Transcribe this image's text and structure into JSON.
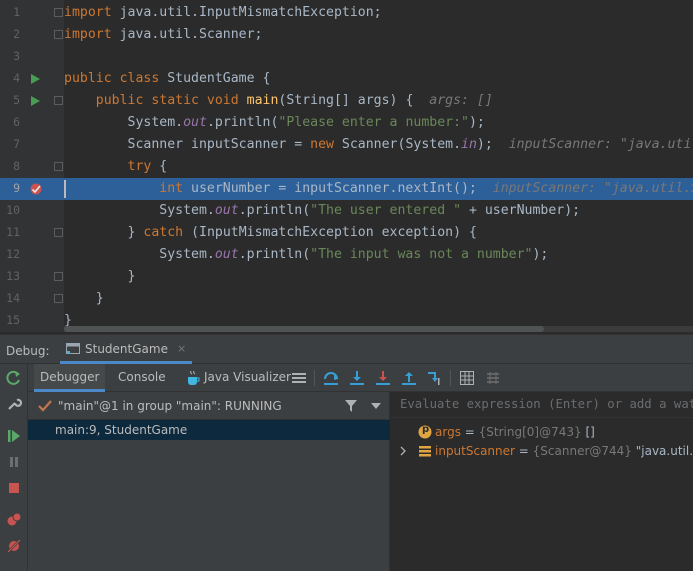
{
  "editor": {
    "lines": [
      {
        "n": "1"
      },
      {
        "n": "2"
      },
      {
        "n": "3"
      },
      {
        "n": "4"
      },
      {
        "n": "5"
      },
      {
        "n": "6"
      },
      {
        "n": "7"
      },
      {
        "n": "8"
      },
      {
        "n": "9"
      },
      {
        "n": "10"
      },
      {
        "n": "11"
      },
      {
        "n": "12"
      },
      {
        "n": "13"
      },
      {
        "n": "14"
      },
      {
        "n": "15"
      }
    ],
    "code": {
      "l1_kw": "import",
      "l1_rest": " java.util.InputMismatchException;",
      "l2_kw": "import",
      "l2_rest": " java.util.Scanner;",
      "l4_kw": "public class",
      "l4_rest": " StudentGame {",
      "l5_kw": "public static void",
      "l5_fn": "main",
      "l5_rest": "(String[] args) {",
      "l5_hint": "args: []",
      "l6_a": "System.",
      "l6_fld": "out",
      "l6_b": ".println(",
      "l6_str": "\"Please enter a number:\"",
      "l6_c": ");",
      "l7_a": "Scanner inputScanner = ",
      "l7_kw": "new",
      "l7_b": " Scanner(System.",
      "l7_fld": "in",
      "l7_c": ");",
      "l7_hint": "inputScanner: \"java.util.Scanner[delimiters=",
      "l8_kw": "try",
      "l8_rest": " {",
      "l9_kw": "int",
      "l9_rest": " userNumber = inputScanner.nextInt();",
      "l9_hint": "inputScanner: \"java.util.Scanner[deli",
      "l10_a": "System.",
      "l10_fld": "out",
      "l10_b": ".println(",
      "l10_str": "\"The user entered \"",
      "l10_c": " + userNumber);",
      "l11_a": "} ",
      "l11_kw": "catch",
      "l11_b": " (InputMismatchException exception) {",
      "l12_a": "System.",
      "l12_fld": "out",
      "l12_b": ".println(",
      "l12_str": "\"The input was not a number\"",
      "l12_c": ");",
      "l13": "}",
      "l14": "}",
      "l15": "}"
    }
  },
  "debug": {
    "title": "Debug:",
    "session_tab": "StudentGame",
    "session_close": "×",
    "tabs": {
      "debugger": "Debugger",
      "console": "Console",
      "visualizer": "Java Visualizer"
    },
    "thread": "\"main\"@1 in group \"main\": RUNNING",
    "frame": "main:9, StudentGame",
    "eval_placeholder": "Evaluate expression (Enter) or add a watch (Ctrl+Shift+Enter)",
    "variables": [
      {
        "badge": "p",
        "name": "args",
        "eq": " = ",
        "ref": "{String[0]@743}",
        "val": " []"
      },
      {
        "badge": "f",
        "name": "inputScanner",
        "eq": " = ",
        "ref": "{Scanner@744}",
        "val": " \"java.util.Scanner[delimiters=\\p{javaWhitespace}+]\""
      }
    ]
  },
  "colors": {
    "run_green": "#499c54",
    "breakpoint_red": "#c75450",
    "accent_blue": "#4a88c7",
    "selection": "#2d6099"
  }
}
